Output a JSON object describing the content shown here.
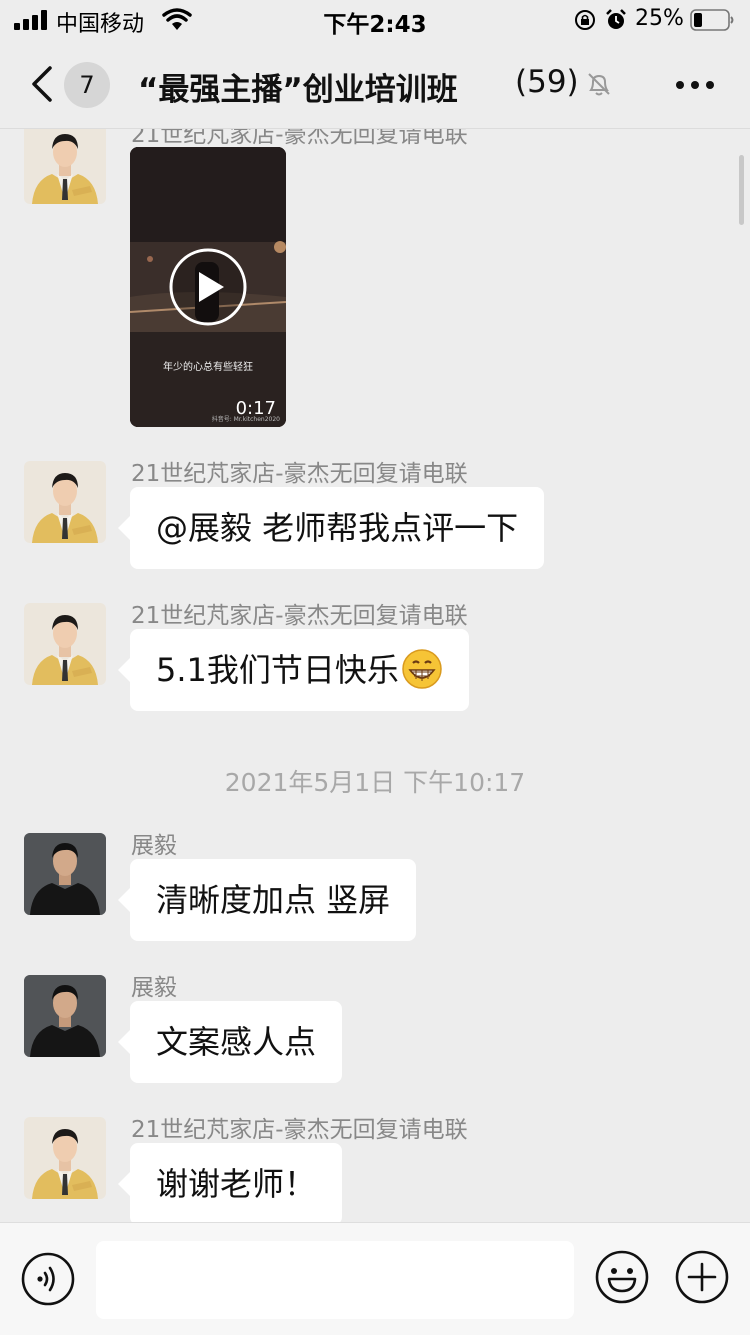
{
  "status_bar": {
    "carrier": "中国移动",
    "time": "下午2:43",
    "battery_percent": "25%",
    "battery_level": 0.25,
    "icons": [
      "signal-icon",
      "wifi-icon",
      "orientation-lock-icon",
      "alarm-icon",
      "battery-icon"
    ]
  },
  "nav": {
    "unread_count": "7",
    "title": "“最强主播”创业培训班",
    "member_count": "(59)",
    "icons": [
      "back-chevron-icon",
      "mute-bell-icon",
      "more-icon"
    ]
  },
  "messages": [
    {
      "type": "video",
      "sender": "21世纪芃家店-豪杰无回复请电联",
      "avatar": "man-yellow-suit",
      "video_caption": "年少的心总有些轻狂",
      "duration": "0:17",
      "watermark": "抖音号: Mr.kitchen2020"
    },
    {
      "type": "text",
      "sender": "21世纪芃家店-豪杰无回复请电联",
      "avatar": "man-yellow-suit",
      "text": "@展毅 老师帮我点评一下"
    },
    {
      "type": "text",
      "sender": "21世纪芃家店-豪杰无回复请电联",
      "avatar": "man-yellow-suit",
      "text": "5.1我们节日快乐",
      "emoji": "grin-emoji"
    },
    {
      "type": "timestamp",
      "text": "2021年5月1日 下午10:17"
    },
    {
      "type": "text",
      "sender": "展毅",
      "avatar": "man-black-shirt",
      "text": "清晰度加点 竖屏"
    },
    {
      "type": "text",
      "sender": "展毅",
      "avatar": "man-black-shirt",
      "text": "文案感人点"
    },
    {
      "type": "text",
      "sender": "21世纪芃家店-豪杰无回复请电联",
      "avatar": "man-yellow-suit",
      "text": "谢谢老师！"
    }
  ],
  "input_bar": {
    "input_value": "",
    "icons": [
      "voice-icon",
      "emoji-icon",
      "plus-icon"
    ]
  }
}
